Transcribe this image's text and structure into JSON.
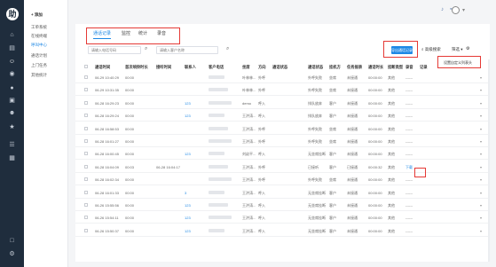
{
  "rail": {
    "logo": "助",
    "icons": [
      "home-icon",
      "chart-icon",
      "user-icon",
      "location-icon",
      "chat-icon",
      "folder-icon",
      "person-icon",
      "star-icon",
      "list-icon",
      "grid-icon",
      "monitor-icon",
      "settings-icon"
    ],
    "glyphs": [
      "⌂",
      "▤",
      "☺",
      "◉",
      "●",
      "▣",
      "☻",
      "★",
      "☰",
      "▦",
      "□",
      "⚙"
    ]
  },
  "submenu": {
    "add": "+ 添加",
    "items": [
      "工单系统",
      "在线终端",
      "呼叫中心",
      "通话计划",
      "上门任务",
      "其他统计"
    ],
    "active_index": 2
  },
  "topbar": {
    "bell": "♪",
    "wifi": "≈",
    "user": "●"
  },
  "tabs": [
    {
      "label": "通话记录",
      "active": true
    },
    {
      "label": "监控",
      "active": false
    },
    {
      "label": "统计",
      "active": false
    },
    {
      "label": "录音",
      "active": false
    }
  ],
  "search1": {
    "placeholder": "请输入电话号码"
  },
  "search2": {
    "placeholder": "请输入客户名称"
  },
  "toolbar": {
    "export": "导出通话记录",
    "advanced": "高级搜索",
    "filter": "筛选 ▾",
    "settings_menu": "设置自定义列表头"
  },
  "columns": [
    "通话时间",
    "首次响铃时长",
    "接听时间",
    "联系人",
    "客户电话",
    "坐席",
    "方向",
    "通话状态",
    "通话状态",
    "挂机方",
    "任务报表",
    "通话时长",
    "挂断类型",
    "录音",
    "记录"
  ],
  "rows": [
    {
      "time": "06-29 10:40:29",
      "ring": "00:00",
      "answer": "",
      "contact": "",
      "agent": "叶林林...",
      "dir": "外呼",
      "status": "外呼失败",
      "hang": "坐席",
      "task": "未接通",
      "dur": "00:00:00",
      "type": "其他",
      "rec": "------"
    },
    {
      "time": "06-29 10:31:35",
      "ring": "00:00",
      "answer": "",
      "contact": "",
      "agent": "叶林林...",
      "dir": "外呼",
      "status": "外呼失败",
      "hang": "坐席",
      "task": "未接通",
      "dur": "00:00:00",
      "type": "其他",
      "rec": "------"
    },
    {
      "time": "06-28 16:29:23",
      "ring": "00:00",
      "answer": "",
      "contact": "123",
      "agent": "demo",
      "dir": "呼入",
      "status": "排队放弃",
      "hang": "客户",
      "task": "未接通",
      "dur": "00:00:00",
      "type": "其他",
      "rec": "------"
    },
    {
      "time": "06-28 16:29:24",
      "ring": "00:00",
      "answer": "",
      "contact": "123",
      "agent": "王洪涛...",
      "dir": "呼入",
      "status": "排队放弃",
      "hang": "客户",
      "task": "未接通",
      "dur": "00:00:00",
      "type": "其他",
      "rec": "------"
    },
    {
      "time": "06-28 16:58:53",
      "ring": "00:00",
      "answer": "",
      "contact": "",
      "agent": "王洪涛...",
      "dir": "外呼",
      "status": "外呼失败",
      "hang": "坐席",
      "task": "未接通",
      "dur": "00:00:00",
      "type": "其他",
      "rec": "------"
    },
    {
      "time": "06-28 16:01:27",
      "ring": "00:00",
      "answer": "",
      "contact": "",
      "agent": "王洪涛...",
      "dir": "外呼",
      "status": "外呼失败",
      "hang": "坐席",
      "task": "未接通",
      "dur": "00:00:00",
      "type": "其他",
      "rec": "------"
    },
    {
      "time": "06-28 16:00:45",
      "ring": "00:00",
      "answer": "",
      "contact": "123",
      "agent": "刘幼平...",
      "dir": "呼入",
      "status": "无坐席挂断",
      "hang": "客户",
      "task": "未接通",
      "dur": "00:00:00",
      "type": "其他",
      "rec": "------"
    },
    {
      "time": "06-28 16:04:09",
      "ring": "00:03",
      "answer": "06-28 16:04:17",
      "contact": "",
      "agent": "王洪涛...",
      "dir": "外呼",
      "status": "已接听",
      "hang": "客户",
      "task": "已接通",
      "dur": "00:00:32",
      "type": "其他",
      "rec": "下载"
    },
    {
      "time": "06-28 16:02:34",
      "ring": "00:00",
      "answer": "",
      "contact": "",
      "agent": "王洪涛...",
      "dir": "外呼",
      "status": "外呼失败",
      "hang": "坐席",
      "task": "未接通",
      "dur": "00:00:00",
      "type": "其他",
      "rec": "------"
    },
    {
      "time": "06-28 16:01:33",
      "ring": "00:00",
      "answer": "",
      "contact": "3",
      "agent": "王洪涛...",
      "dir": "呼入",
      "status": "无坐席挂断",
      "hang": "客户",
      "task": "未接通",
      "dur": "00:00:00",
      "type": "其他",
      "rec": "------"
    },
    {
      "time": "06-26 15:55:56",
      "ring": "00:00",
      "answer": "",
      "contact": "123",
      "agent": "王洪涛...",
      "dir": "呼入",
      "status": "无坐席挂断",
      "hang": "客户",
      "task": "未接通",
      "dur": "00:00:00",
      "type": "其他",
      "rec": "------"
    },
    {
      "time": "06-26 15:54:11",
      "ring": "00:00",
      "answer": "",
      "contact": "123",
      "agent": "王洪涛...",
      "dir": "呼入",
      "status": "无坐席挂断",
      "hang": "客户",
      "task": "未接通",
      "dur": "00:00:00",
      "type": "其他",
      "rec": "------"
    },
    {
      "time": "06-26 15:50:37",
      "ring": "00:00",
      "answer": "",
      "contact": "123",
      "agent": "王洪涛...",
      "dir": "呼入",
      "status": "无坐席挂断",
      "hang": "客户",
      "task": "未接通",
      "dur": "00:00:00",
      "type": "其他",
      "rec": "------"
    }
  ],
  "colors": {
    "accent": "#1e88e5",
    "rail": "#1f2d3d",
    "highlight_box": "#e53935"
  }
}
